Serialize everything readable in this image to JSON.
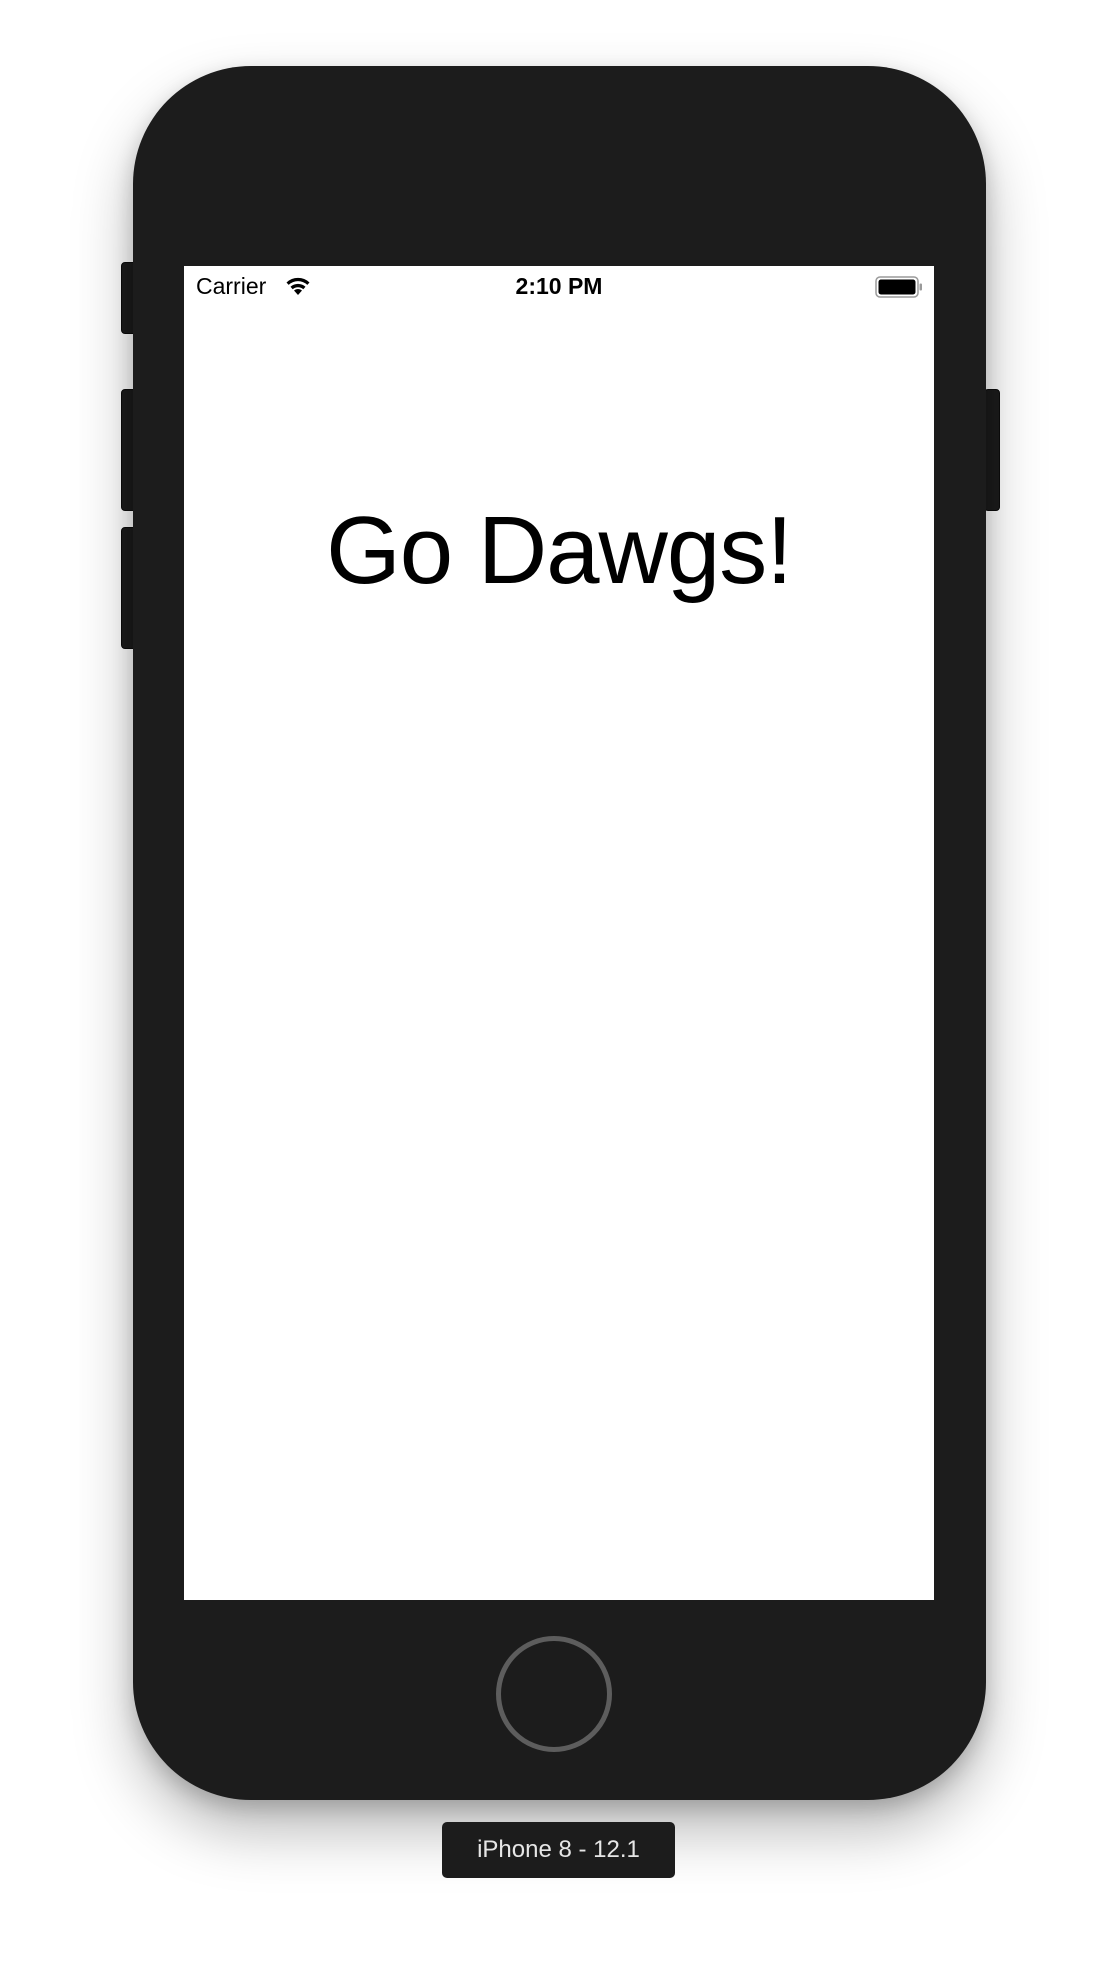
{
  "status_bar": {
    "carrier": "Carrier",
    "time": "2:10 PM",
    "wifi_icon": "wifi-icon",
    "battery_icon": "battery-icon"
  },
  "screen": {
    "headline": "Go Dawgs!",
    "background_color": "#ffffff"
  },
  "device": {
    "label": "iPhone 8 - 12.1",
    "body_color": "#1c1c1c"
  }
}
